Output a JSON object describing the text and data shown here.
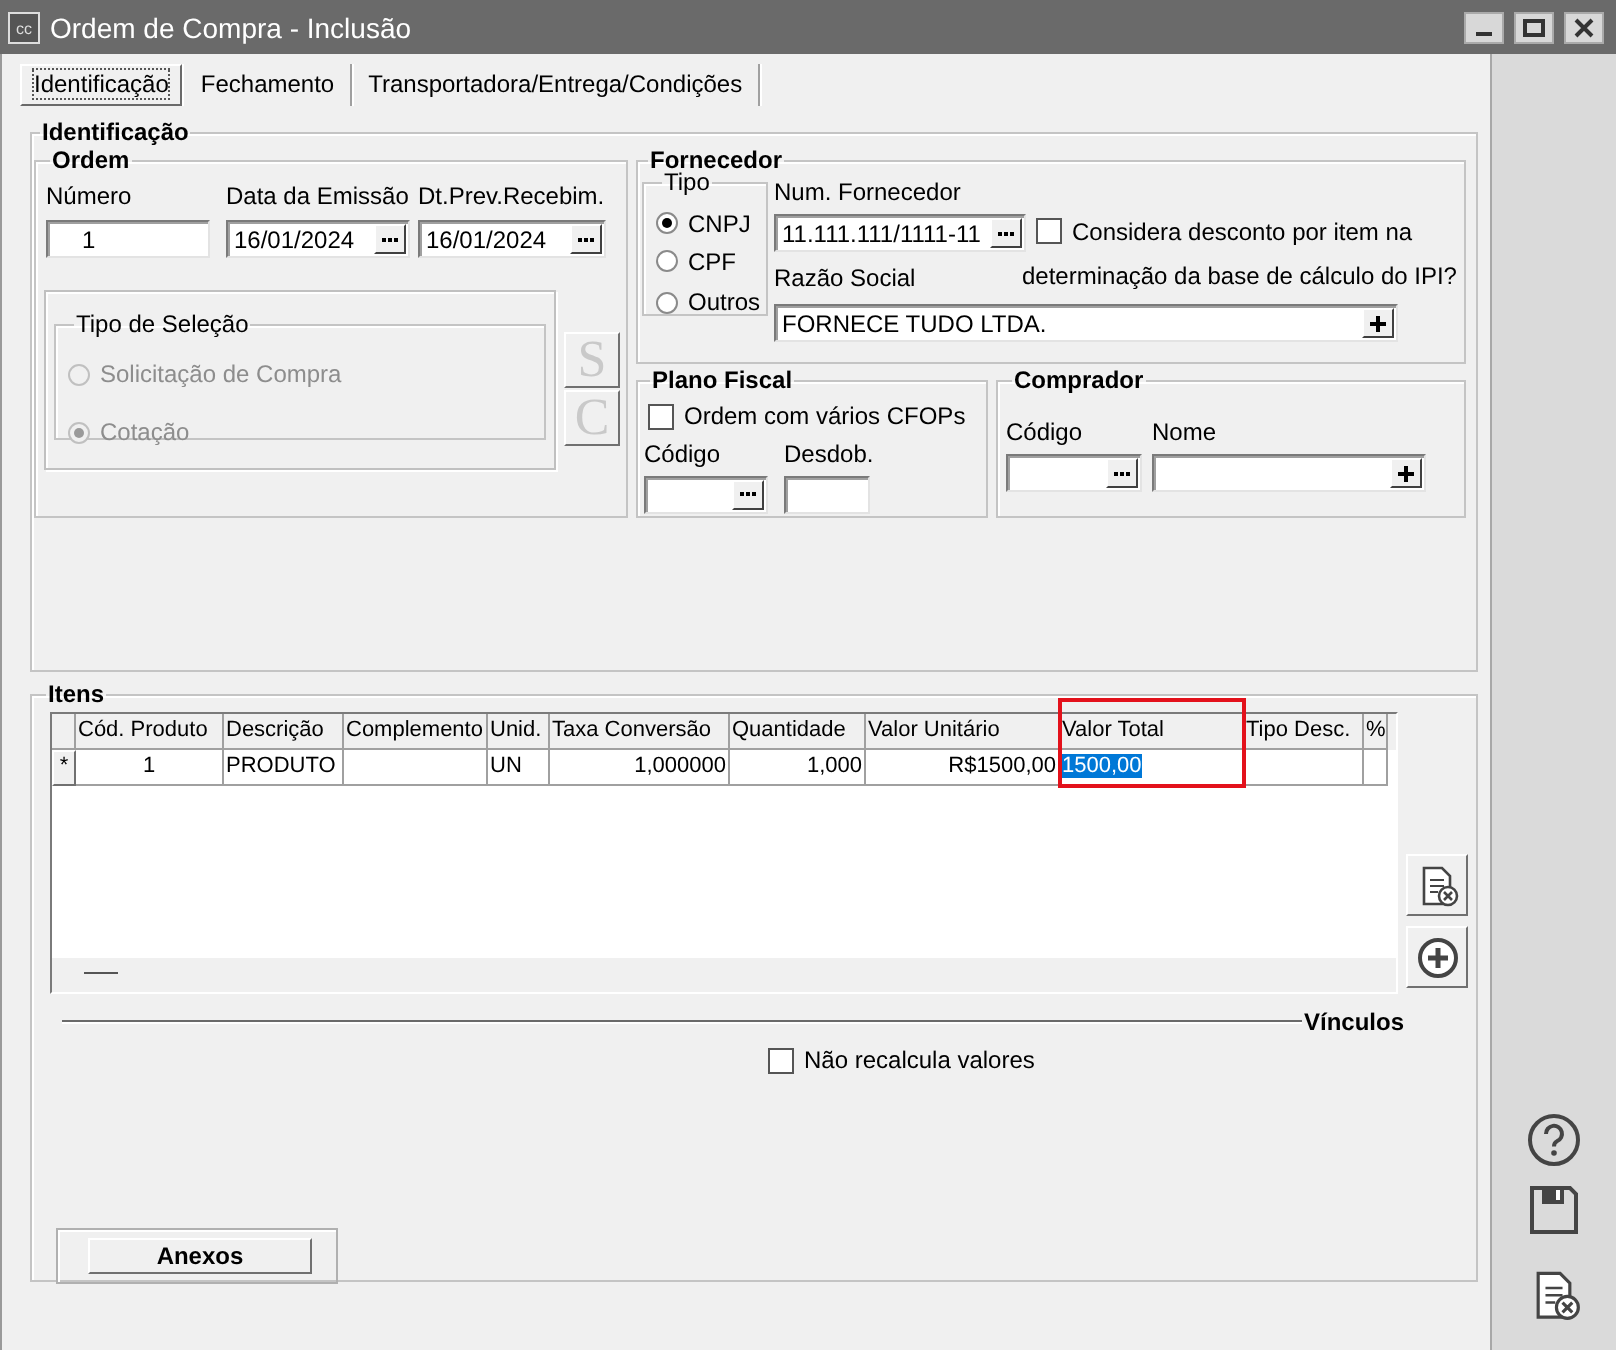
{
  "window": {
    "title": "Ordem de Compra - Inclusão",
    "icon_label": "cc"
  },
  "tabs": [
    {
      "label": "Identificação",
      "selected": true
    },
    {
      "label": "Fechamento",
      "selected": false
    },
    {
      "label": "Transportadora/Entrega/Condições",
      "selected": false
    }
  ],
  "identificacao": {
    "title": "Identificação",
    "ordem": {
      "title": "Ordem",
      "fields": [
        {
          "label": "Número",
          "value": "1",
          "kind": "number"
        },
        {
          "label": "Data da Emissão",
          "value": "16/01/2024",
          "kind": "lookup"
        },
        {
          "label": "Dt.Prev.Recebim.",
          "value": "16/01/2024",
          "kind": "lookup"
        }
      ],
      "tipo_selecao": {
        "title": "Tipo de Seleção",
        "options": [
          {
            "label": "Solicitação de Compra",
            "selected": false,
            "disabled": true
          },
          {
            "label": "Cotação",
            "selected": true,
            "disabled": true
          }
        ]
      },
      "buttons": [
        {
          "label": "S",
          "disabled": true
        },
        {
          "label": "C",
          "disabled": true
        }
      ]
    },
    "fornecedor": {
      "title": "Fornecedor",
      "tipo": {
        "title": "Tipo",
        "options": [
          {
            "label": "CNPJ",
            "selected": true
          },
          {
            "label": "CPF",
            "selected": false
          },
          {
            "label": "Outros",
            "selected": false
          }
        ]
      },
      "num_fornecedor": {
        "label": "Num. Fornecedor",
        "value": "11.111.111/1111-11",
        "kind": "lookup"
      },
      "desconto_por_item": {
        "label": "Considera desconto por item na determinação da base de cálculo do IPI?",
        "checked": false
      },
      "razao_social": {
        "label": "Razão Social",
        "value": "FORNECE TUDO LTDA.",
        "kind": "add"
      }
    },
    "plano_fiscal": {
      "title": "Plano Fiscal",
      "varios_cfops": {
        "label": "Ordem com vários CFOPs",
        "checked": false
      },
      "codigo": {
        "label": "Código",
        "kind": "lookup"
      },
      "desdobramento": {
        "label": "Desdob.",
        "kind": "text"
      }
    },
    "comprador": {
      "title": "Comprador",
      "codigo": {
        "label": "Código",
        "kind": "lookup"
      },
      "nome": {
        "label": "Nome",
        "kind": "add"
      }
    }
  },
  "itens": {
    "title": "Itens",
    "columns": [
      {
        "label": "Cód. Produto",
        "highlighted": false
      },
      {
        "label": "Descrição",
        "highlighted": false
      },
      {
        "label": "Complemento",
        "highlighted": false
      },
      {
        "label": "Unid.",
        "highlighted": false
      },
      {
        "label": "Taxa Conversão",
        "highlighted": false
      },
      {
        "label": "Quantidade",
        "highlighted": false
      },
      {
        "label": "Valor Unitário",
        "highlighted": false
      },
      {
        "label": "Valor Total",
        "highlighted": true
      },
      {
        "label": "Tipo Desc.",
        "highlighted": false
      },
      {
        "label": "%",
        "highlighted": false
      }
    ],
    "rows": [
      {
        "marker": "*",
        "cells": [
          {
            "text": "1",
            "selected": false
          },
          {
            "text": "PRODUTO",
            "selected": false
          },
          {
            "selected": false
          },
          {
            "text": "UN",
            "selected": false
          },
          {
            "text": "1,000000",
            "selected": false
          },
          {
            "text": "1,000",
            "selected": false
          },
          {
            "text": "R$1500,00",
            "selected": false
          },
          {
            "text": "1500,00",
            "selected": true
          },
          {
            "selected": false
          },
          {
            "selected": false
          }
        ]
      }
    ]
  },
  "vinculos": {
    "title": "Vínculos",
    "nao_recalcula": {
      "label": "Não recalcula valores",
      "checked": false
    }
  },
  "anexos": {
    "label": "Anexos"
  }
}
